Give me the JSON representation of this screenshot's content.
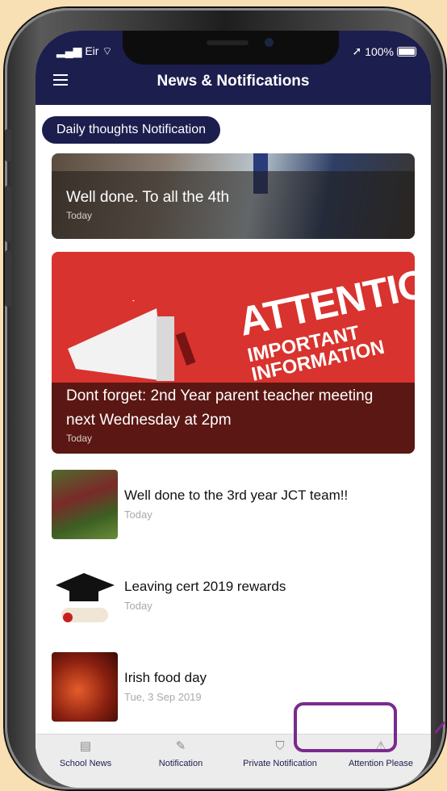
{
  "status": {
    "carrier": "Eir",
    "battery": "100%"
  },
  "header": {
    "title": "News & Notifications"
  },
  "category": {
    "label": "Daily thoughts Notification"
  },
  "cards": [
    {
      "title": "Well done. To all the 4th",
      "date": "Today"
    },
    {
      "title": "Dont forget: 2nd Year parent teacher meeting next Wednesday at 2pm",
      "date": "Today",
      "image_text": {
        "main": "ATTENTION",
        "sub1": "IMPORTANT",
        "sub2": "INFORMATION"
      }
    }
  ],
  "list": [
    {
      "title": "Well done to the 3rd year JCT team!!",
      "date": "Today",
      "icon": "rugby-photo"
    },
    {
      "title": "Leaving cert 2019 rewards",
      "date": "Today",
      "icon": "graduation-cap-photo"
    },
    {
      "title": "Irish food day",
      "date": "Tue, 3 Sep 2019",
      "icon": "food-photo"
    }
  ],
  "tabs": [
    {
      "label": "School News",
      "icon": "newspaper-icon"
    },
    {
      "label": "Notification",
      "icon": "pen-icon"
    },
    {
      "label": "Private Notification",
      "icon": "shield-icon"
    },
    {
      "label": "Attention Please",
      "icon": "warning-icon"
    }
  ],
  "colors": {
    "navy": "#1c1e4e",
    "highlight": "#7a2a8c",
    "background": "#f8dfb4"
  }
}
